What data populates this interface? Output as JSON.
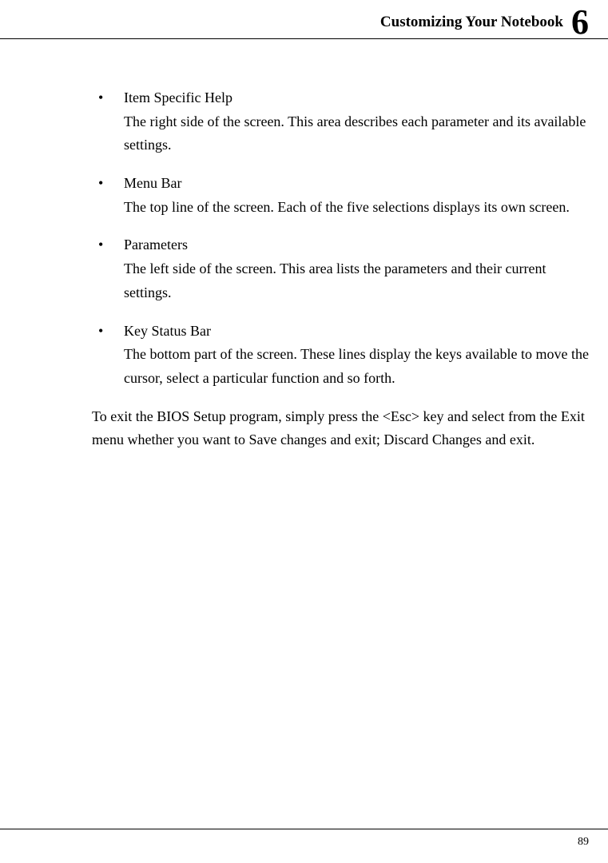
{
  "header": {
    "title": "Customizing Your Notebook",
    "chapter_number": "6"
  },
  "items": [
    {
      "title": "Item Specific Help",
      "description": "The right side of the screen. This area describes each parameter and its available settings."
    },
    {
      "title": "Menu Bar",
      "description": "The top line of the screen. Each of the five selections displays its own screen."
    },
    {
      "title": "Parameters",
      "description": "The left side of the screen. This area lists the parameters and their current settings."
    },
    {
      "title": "Key Status Bar",
      "description": "The bottom part of the screen. These lines display the keys available to move the cursor, select a particular function and so forth."
    }
  ],
  "exit_paragraph": "To exit the BIOS Setup program, simply press the <Esc> key and select from the Exit menu whether you want to Save changes and exit; Discard Changes and exit.",
  "page_number": "89"
}
